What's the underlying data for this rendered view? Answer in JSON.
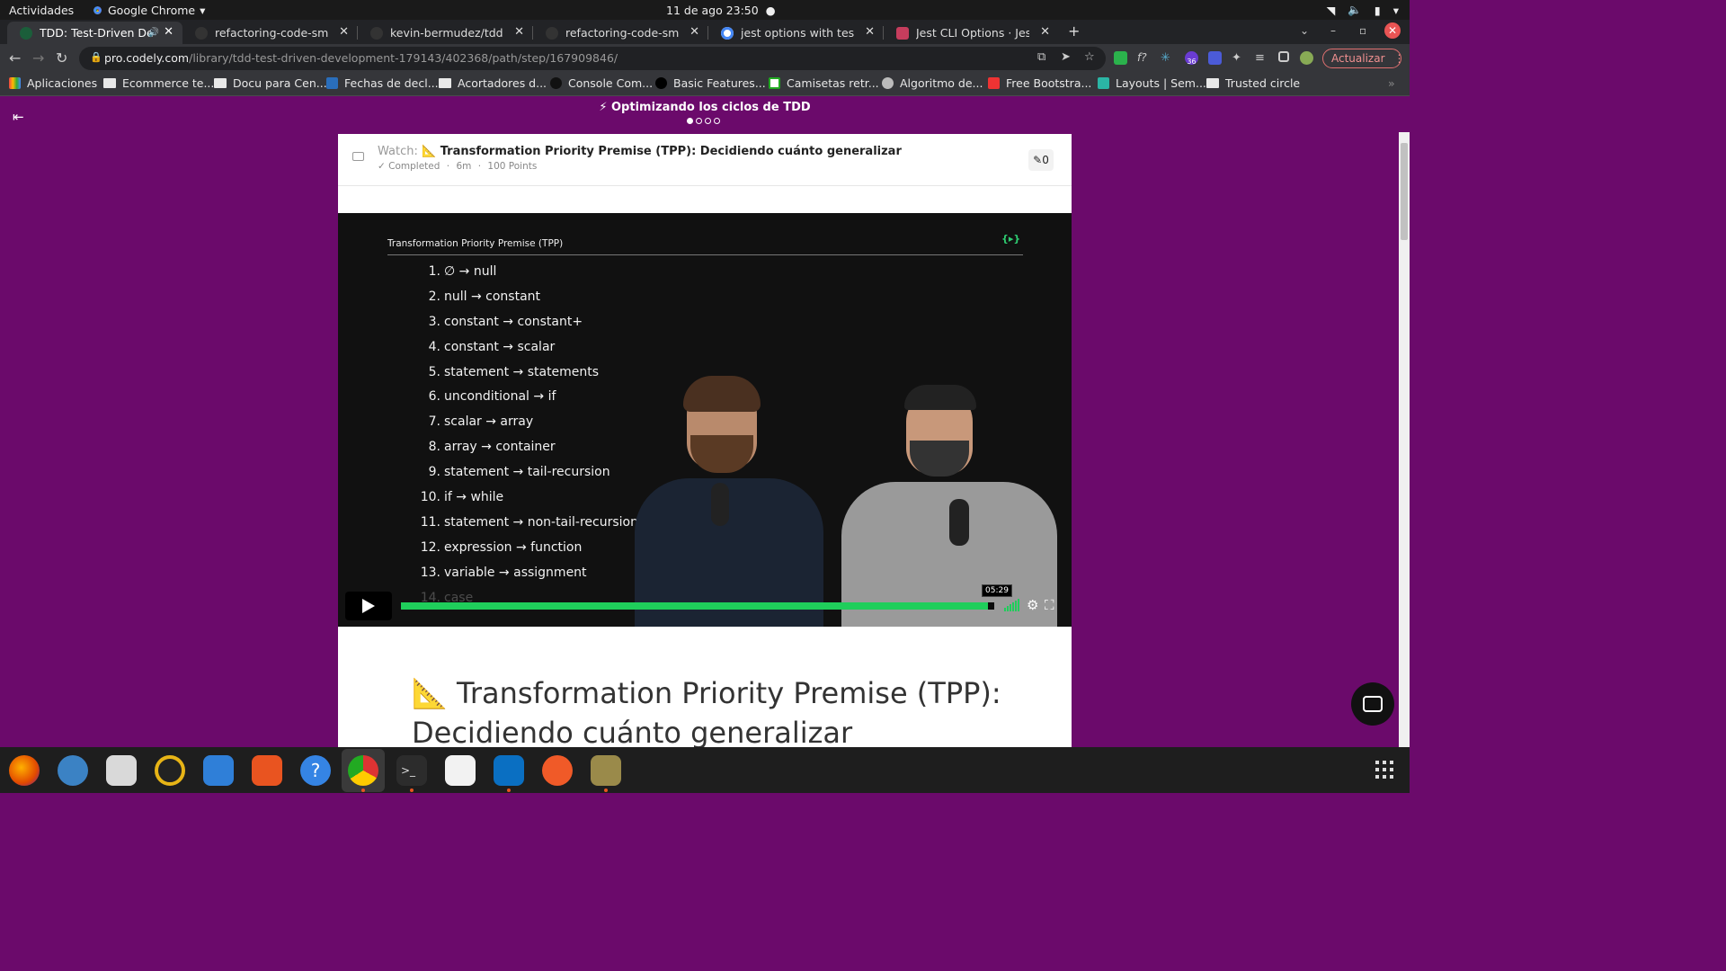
{
  "system": {
    "activities": "Actividades",
    "app_name": "Google Chrome",
    "clock": "11 de ago  23:50"
  },
  "tabs": [
    {
      "title": "TDD: Test-Driven Deve",
      "active": true
    },
    {
      "title": "refactoring-code-smells/e",
      "active": false
    },
    {
      "title": "kevin-bermudez/tdd-type",
      "active": false
    },
    {
      "title": "refactoring-code-smells/e",
      "active": false
    },
    {
      "title": "jest options with testpatt",
      "active": false
    },
    {
      "title": "Jest CLI Options · Jest",
      "active": false
    }
  ],
  "address": {
    "domain": "pro.codely.com",
    "path": "/library/tdd-test-driven-development-179143/402368/path/step/167909846/",
    "update_label": "Actualizar",
    "ext_badge": "36"
  },
  "bookmarks": [
    "Aplicaciones",
    "Ecommerce te...",
    "Docu para Cen...",
    "Fechas de decl...",
    "Acortadores d...",
    "Console Com...",
    "Basic Features...",
    "Camisetas retr...",
    "Algoritmo de...",
    "Free Bootstra...",
    "Layouts | Sem...",
    "Trusted circle"
  ],
  "page": {
    "course_title": "⚡ Optimizando los ciclos de TDD",
    "watch_prefix": "Watch:",
    "lesson_name": "📐 Transformation Priority Premise (TPP): Decidiendo cuánto generalizar",
    "status": "✓ Completed",
    "duration": "6m",
    "points": "100 Points",
    "notes_count": "0",
    "heading_line1": "📐 Transformation Priority Premise (TPP):",
    "heading_line2": "Decidiendo cuánto generalizar"
  },
  "video": {
    "slide_title": "Transformation Priority Premise (TPP)",
    "logo": "{▸}",
    "items": [
      {
        "n": "1.",
        "t": "∅ → null"
      },
      {
        "n": "2.",
        "t": "null → constant"
      },
      {
        "n": "3.",
        "t": "constant → constant+"
      },
      {
        "n": "4.",
        "t": "constant → scalar"
      },
      {
        "n": "5.",
        "t": "statement → statements"
      },
      {
        "n": "6.",
        "t": "unconditional → if"
      },
      {
        "n": "7.",
        "t": "scalar → array"
      },
      {
        "n": "8.",
        "t": "array → container"
      },
      {
        "n": "9.",
        "t": "statement → tail-recursion"
      },
      {
        "n": "10.",
        "t": "if → while"
      },
      {
        "n": "11.",
        "t": "statement → non-tail-recursion"
      },
      {
        "n": "12.",
        "t": "expression → function"
      },
      {
        "n": "13.",
        "t": "variable → assignment"
      },
      {
        "n": "14.",
        "t": "case"
      }
    ],
    "time": "05:29",
    "progress_fraction": 0.99
  },
  "colors": {
    "page_bg": "#6b0a6b",
    "progress": "#1fce5b"
  }
}
